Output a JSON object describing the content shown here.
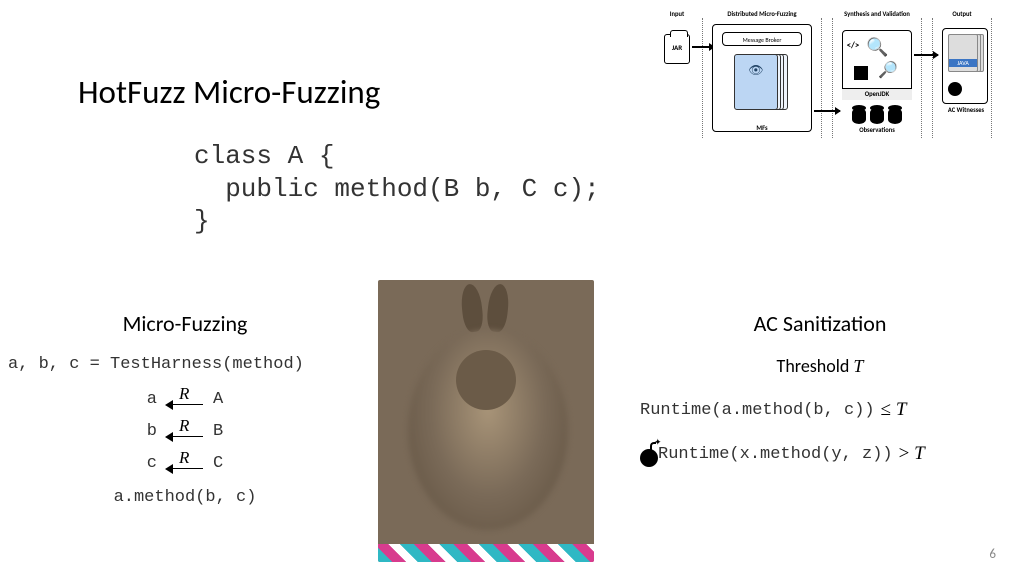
{
  "title": "HotFuzz Micro-Fuzzing",
  "code": {
    "line1": "class A {",
    "line2": "  public method(B b, C c);",
    "line3": "}"
  },
  "diagram": {
    "col_input": "Input",
    "col_dist": "Distributed Micro-Fuzzing",
    "col_synth": "Synthesis and Validation",
    "col_output": "Output",
    "jar": "JAR",
    "broker": "Message Broker",
    "mfs": "MFs",
    "openjdk": "OpenJDK",
    "observations": "Observations",
    "java": "JAVA",
    "witnesses": "AC Witnesses"
  },
  "left": {
    "heading": "Micro-Fuzzing",
    "harness": "a, b, c = TestHarness(method)",
    "rows": [
      {
        "lhs": "a",
        "rhs": "A"
      },
      {
        "lhs": "b",
        "rhs": "B"
      },
      {
        "lhs": "c",
        "rhs": "C"
      }
    ],
    "arrow_label": "R",
    "call": "a.method(b, c)"
  },
  "right": {
    "heading": "AC Sanitization",
    "threshold_prefix": "Threshold ",
    "threshold_var": "T",
    "row1_code": "Runtime(a.method(b, c))",
    "row1_rel": " ≤ ",
    "row2_code": "Runtime(x.method(y, z))",
    "row2_rel": " > ",
    "T": "T"
  },
  "page_number": "6"
}
